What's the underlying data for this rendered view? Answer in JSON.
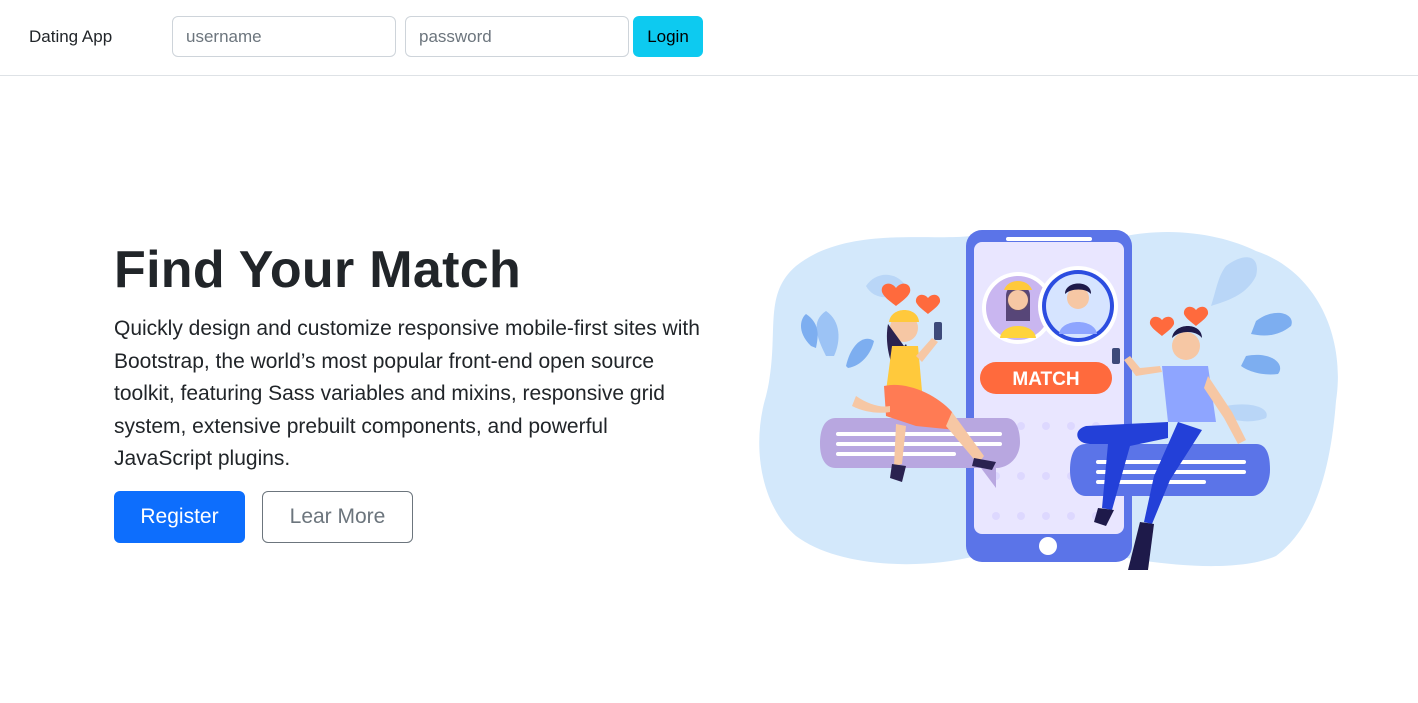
{
  "navbar": {
    "brand": "Dating App",
    "username_placeholder": "username",
    "password_placeholder": "password",
    "login_label": "Login"
  },
  "hero": {
    "title": "Find Your Match",
    "lead": "Quickly design and customize responsive mobile-first sites with Bootstrap, the world’s most popular front-end open source toolkit, featuring Sass variables and mixins, responsive grid system, extensive prebuilt components, and powerful JavaScript plugins.",
    "register_label": "Register",
    "learn_more_label": "Lear More"
  },
  "illustration": {
    "badge_text": "MATCH",
    "icons": [
      "heart-icon",
      "phone-icon",
      "avatar-woman-icon",
      "avatar-man-icon"
    ]
  },
  "colors": {
    "primary": "#0d6efd",
    "info": "#0dcaf0",
    "match_badge": "#ff6a3d",
    "phone": "#5b74e8",
    "blob": "#d3e8fb"
  }
}
